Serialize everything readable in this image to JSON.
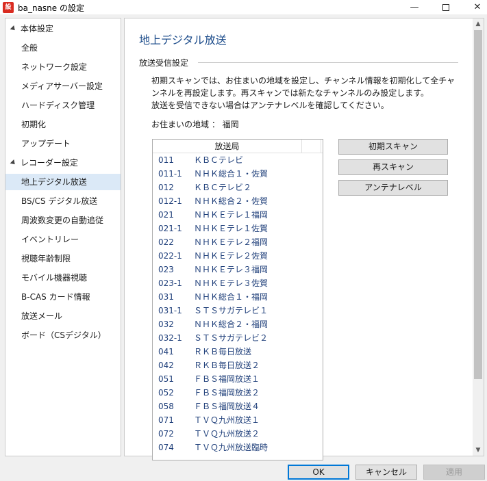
{
  "window": {
    "title": "ba_nasne の設定",
    "icon": "nasne-app-icon",
    "icon_text": "設",
    "minimize_glyph": "—",
    "close_glyph": "✕"
  },
  "sidebar": {
    "groups": [
      {
        "label": "本体設定",
        "items": [
          "全般",
          "ネットワーク設定",
          "メディアサーバー設定",
          "ハードディスク管理",
          "初期化",
          "アップデート"
        ]
      },
      {
        "label": "レコーダー設定",
        "items": [
          "地上デジタル放送",
          "BS/CS デジタル放送",
          "周波数変更の自動追従",
          "イベントリレー",
          "視聴年齢制限",
          "モバイル機器視聴",
          "B-CAS カード情報",
          "放送メール",
          "ボード（CSデジタル）"
        ]
      }
    ],
    "selected": "地上デジタル放送"
  },
  "main": {
    "title": "地上デジタル放送",
    "section": "放送受信設定",
    "description": [
      "初期スキャンでは、お住まいの地域を設定し、チャンネル情報を初期化して全チャ",
      "ンネルを再設定します。再スキャンでは新たなチャンネルのみ設定します。",
      "放送を受信できない場合はアンテナレベルを確認してください。"
    ],
    "region_label": "お住まいの地域 ： 福岡",
    "list_header": "放送局",
    "stations": [
      {
        "ch": "011",
        "name": "ＫＢＣテレビ"
      },
      {
        "ch": "011-1",
        "name": "ＮＨＫ総合１・佐賀"
      },
      {
        "ch": "012",
        "name": "ＫＢＣテレビ２"
      },
      {
        "ch": "012-1",
        "name": "ＮＨＫ総合２・佐賀"
      },
      {
        "ch": "021",
        "name": "ＮＨＫＥテレ１福岡"
      },
      {
        "ch": "021-1",
        "name": "ＮＨＫＥテレ１佐賀"
      },
      {
        "ch": "022",
        "name": "ＮＨＫＥテレ２福岡"
      },
      {
        "ch": "022-1",
        "name": "ＮＨＫＥテレ２佐賀"
      },
      {
        "ch": "023",
        "name": "ＮＨＫＥテレ３福岡"
      },
      {
        "ch": "023-1",
        "name": "ＮＨＫＥテレ３佐賀"
      },
      {
        "ch": "031",
        "name": "ＮＨＫ総合１・福岡"
      },
      {
        "ch": "031-1",
        "name": "ＳＴＳサガテレビ１"
      },
      {
        "ch": "032",
        "name": "ＮＨＫ総合２・福岡"
      },
      {
        "ch": "032-1",
        "name": "ＳＴＳサガテレビ２"
      },
      {
        "ch": "041",
        "name": "ＲＫＢ毎日放送"
      },
      {
        "ch": "042",
        "name": "ＲＫＢ毎日放送２"
      },
      {
        "ch": "051",
        "name": "ＦＢＳ福岡放送１"
      },
      {
        "ch": "052",
        "name": "ＦＢＳ福岡放送２"
      },
      {
        "ch": "058",
        "name": "ＦＢＳ福岡放送４"
      },
      {
        "ch": "071",
        "name": "ＴＶＱ九州放送１"
      },
      {
        "ch": "072",
        "name": "ＴＶＱ九州放送２"
      },
      {
        "ch": "074",
        "name": "ＴＶＱ九州放送臨時"
      }
    ],
    "buttons": {
      "initial_scan": "初期スキャン",
      "rescan": "再スキャン",
      "antenna_level": "アンテナレベル"
    },
    "scroll_up": "▲",
    "scroll_down": "▼"
  },
  "footer": {
    "ok": "OK",
    "cancel": "キャンセル",
    "apply": "適用"
  }
}
